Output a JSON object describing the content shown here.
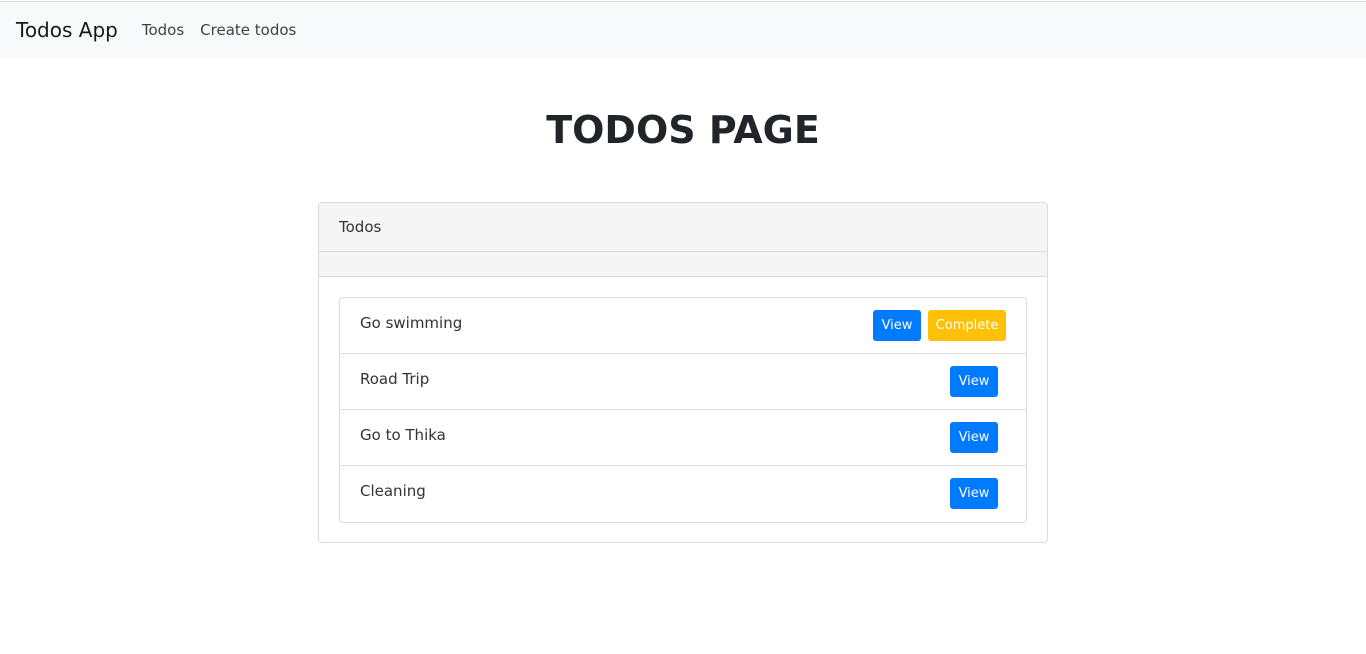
{
  "navbar": {
    "brand": "Todos App",
    "links": [
      "Todos",
      "Create todos"
    ]
  },
  "page_title": "TODOS PAGE",
  "card": {
    "header": "Todos",
    "items": [
      {
        "title": "Go swimming",
        "view_label": "View",
        "complete_label": "Complete"
      },
      {
        "title": "Road Trip",
        "view_label": "View"
      },
      {
        "title": "Go to Thika",
        "view_label": "View"
      },
      {
        "title": "Cleaning",
        "view_label": "View"
      }
    ]
  },
  "colors": {
    "primary": "#007bff",
    "warning": "#ffc107",
    "navbar_bg": "#f8f9fa"
  }
}
